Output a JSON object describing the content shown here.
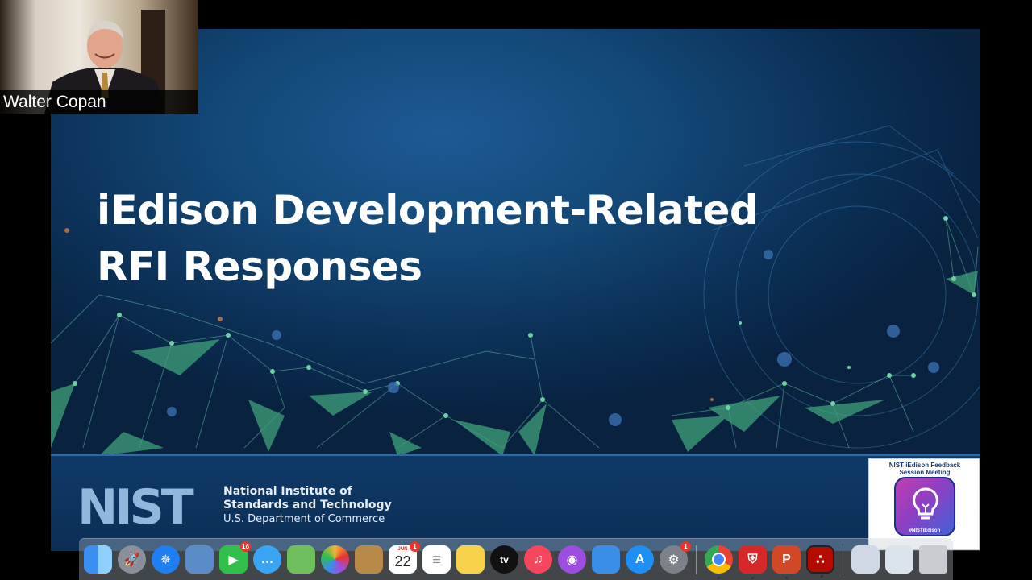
{
  "slide": {
    "title_line1": "iEdison Development-Related",
    "title_line2": "RFI Responses",
    "org": {
      "logo_text": "NIST",
      "line1": "National Institute of",
      "line2": "Standards and Technology",
      "line3": "U.S. Department of Commerce"
    }
  },
  "participant": {
    "name": "Walter Copan"
  },
  "meeting_badge": {
    "line1": "NIST iEdison Feedback",
    "line2": "Session Meeting",
    "tag": "#NISTiEdison"
  },
  "dock": {
    "items": [
      {
        "name": "finder-icon",
        "color": "#3b8ff0"
      },
      {
        "name": "launchpad-icon",
        "color": "#8a8f99"
      },
      {
        "name": "safari-icon",
        "color": "#1f7ef0"
      },
      {
        "name": "preview-icon",
        "color": "#5b8cc7"
      },
      {
        "name": "facetime-icon",
        "color": "#2fbf4a",
        "badge": "16"
      },
      {
        "name": "messages-icon",
        "color": "#3aa4f5"
      },
      {
        "name": "maps-icon",
        "color": "#6fbf5e"
      },
      {
        "name": "photos-icon",
        "color": "#f2b33d"
      },
      {
        "name": "notes-brown-icon",
        "color": "#b88a4a"
      },
      {
        "name": "calendar-icon",
        "color": "#ffffff",
        "month": "JUN",
        "day": "22",
        "badge": "1"
      },
      {
        "name": "reminders-icon",
        "color": "#ffffff"
      },
      {
        "name": "notes-icon",
        "color": "#f7d24a"
      },
      {
        "name": "apple-tv-icon",
        "color": "#111111",
        "label": "tv"
      },
      {
        "name": "music-icon",
        "color": "#f5465e"
      },
      {
        "name": "podcasts-icon",
        "color": "#9d4de0"
      },
      {
        "name": "keynote-icon",
        "color": "#3a8ee6"
      },
      {
        "name": "app-store-icon",
        "color": "#1e90f5"
      },
      {
        "name": "system-preferences-icon",
        "color": "#7d828a",
        "badge": "1"
      },
      {
        "name": "chrome-icon",
        "color": "#ea4335"
      },
      {
        "name": "security-app-icon",
        "color": "#d62828"
      },
      {
        "name": "powerpoint-icon",
        "color": "#d24726",
        "label": "P"
      },
      {
        "name": "acrobat-icon",
        "color": "#b30b00"
      },
      {
        "name": "downloads-icon",
        "color": "#cfd8e4"
      },
      {
        "name": "folder-stack-icon",
        "color": "#dbe3ec"
      },
      {
        "name": "trash-icon",
        "color": "#c9cdd2"
      }
    ]
  }
}
